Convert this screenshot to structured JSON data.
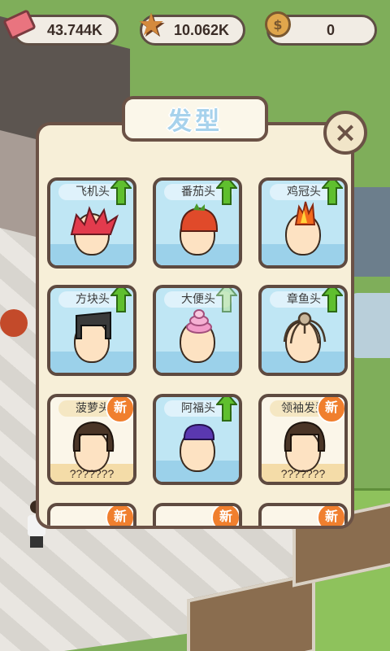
{
  "hud": {
    "cash": "43.744K",
    "stars": "10.062K",
    "coins": "0",
    "icons": [
      "cash-icon",
      "star-icon",
      "coin-icon"
    ]
  },
  "dialog": {
    "title": "发型",
    "close_label": "×",
    "items": [
      {
        "label": "飞机头",
        "status": "upgrade",
        "hair": "red-spiky"
      },
      {
        "label": "番茄头",
        "status": "upgrade",
        "hair": "tomato"
      },
      {
        "label": "鸡冠头",
        "status": "upgrade",
        "hair": "flame-mohawk"
      },
      {
        "label": "方块头",
        "status": "upgrade",
        "hair": "flat-top"
      },
      {
        "label": "大便头",
        "status": "upgrade-dim",
        "hair": "pink-swirl"
      },
      {
        "label": "章鱼头",
        "status": "upgrade",
        "hair": "octopus"
      },
      {
        "label": "菠萝头",
        "status": "new",
        "hair": "bowl",
        "unknown": "???????"
      },
      {
        "label": "阿福头",
        "status": "upgrade",
        "hair": "purple-bowl"
      },
      {
        "label": "领袖发型",
        "status": "new",
        "hair": "bowl",
        "unknown": "???????"
      },
      {
        "label": "",
        "status": "new",
        "hair": ""
      },
      {
        "label": "",
        "status": "new",
        "hair": ""
      },
      {
        "label": "",
        "status": "new",
        "hair": ""
      }
    ],
    "new_badge": "新"
  },
  "colors": {
    "dialog_bg": "#f7efd8",
    "border": "#6b5246",
    "card_blue": "#bfe6f4",
    "card_cream": "#fbf6e9",
    "arrow_green": "#5fbf2e",
    "badge_orange": "#f07f2e",
    "title_blue": "#a7d2ec"
  }
}
